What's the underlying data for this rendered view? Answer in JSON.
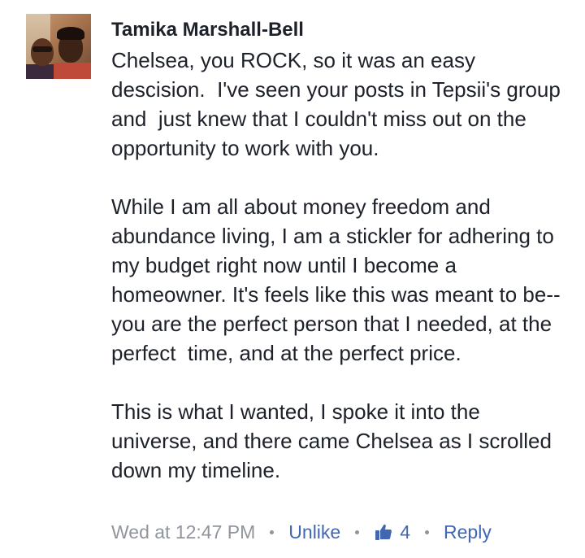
{
  "comment": {
    "author": "Tamika Marshall-Bell",
    "paragraphs": [
      "Chelsea, you ROCK, so it was an easy descision.  I've seen your posts in Tepsii's group and  just knew that I couldn't miss out on the opportunity to work with you.",
      "While I am all about money freedom and abundance living, I am a stickler for adhering to my budget right now until I become a homeowner. It's feels like this was meant to be--you are the perfect person that I needed, at the perfect  time, and at the perfect price.",
      "This is what I wanted, I spoke it into the universe, and there came Chelsea as I scrolled down my timeline."
    ],
    "timestamp": "Wed at 12:47 PM",
    "unlike_label": "Unlike",
    "like_icon": "thumbs-up-icon",
    "like_count": "4",
    "reply_label": "Reply"
  },
  "colors": {
    "text": "#1d2129",
    "meta": "#90949c",
    "link": "#4267b2"
  }
}
